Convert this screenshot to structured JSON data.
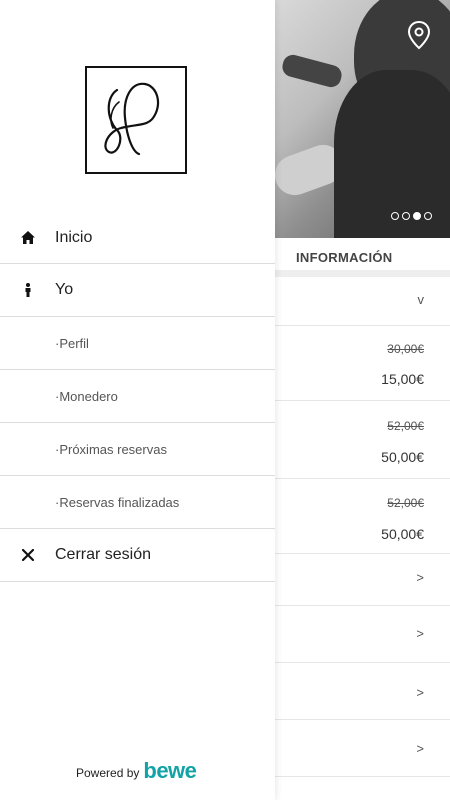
{
  "background": {
    "info_title": "INFORMACIÓN",
    "first_row_chevron": "v",
    "services": [
      {
        "old_price": "30,00€",
        "new_price": "15,00€"
      },
      {
        "old_price": "52,00€",
        "new_price": "50,00€"
      },
      {
        "old_price": "52,00€",
        "new_price": "50,00€"
      }
    ],
    "link_chevrons": [
      ">",
      ">",
      ">",
      ">"
    ],
    "carousel_active_index": 2,
    "carousel_count": 4
  },
  "drawer": {
    "menu": [
      {
        "label": "Inicio",
        "icon": "home-icon"
      },
      {
        "label": "Yo",
        "icon": "person-icon"
      }
    ],
    "submenu": [
      {
        "label": "·Perfil"
      },
      {
        "label": "·Monedero"
      },
      {
        "label": "·Próximas reservas"
      },
      {
        "label": "·Reservas finalizadas"
      }
    ],
    "logout": {
      "label": "Cerrar sesión",
      "icon": "close-icon"
    },
    "powered_by": "Powered by",
    "brand": "bewe"
  },
  "colors": {
    "brand": "#13a3a7"
  }
}
